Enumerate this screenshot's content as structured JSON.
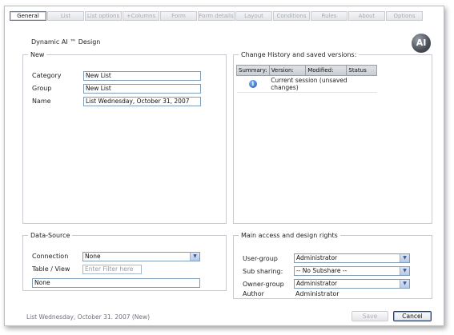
{
  "tabs": [
    {
      "label": "General",
      "active": true
    },
    {
      "label": "List",
      "active": false
    },
    {
      "label": "List options",
      "active": false
    },
    {
      "label": "+Columns",
      "active": false
    },
    {
      "label": "Form",
      "active": false
    },
    {
      "label": "Form details",
      "active": false
    },
    {
      "label": "Layout",
      "active": false
    },
    {
      "label": "Conditions",
      "active": false
    },
    {
      "label": "Rules",
      "active": false
    },
    {
      "label": "About",
      "active": false
    },
    {
      "label": "Options",
      "active": false
    }
  ],
  "page_title": "Dynamic AI ™ Design",
  "logo_text": "AI",
  "new_section": {
    "legend": "New",
    "category_label": "Category",
    "category_value": "New List",
    "group_label": "Group",
    "group_value": "New List",
    "name_label": "Name",
    "name_value": "List Wednesday, October 31, 2007"
  },
  "history_section": {
    "legend": "Change History and saved versions:",
    "columns": [
      "Summary:",
      "Version:",
      "Modified:",
      "Status"
    ],
    "rows": [
      {
        "icon": "info-icon",
        "text": "Current session (unsaved changes)"
      }
    ]
  },
  "datasource_section": {
    "legend": "Data-Source",
    "connection_label": "Connection",
    "connection_value": "None",
    "tableview_label": "Table / View",
    "filter_placeholder": "Enter Filter here",
    "selected_value": "None"
  },
  "access_section": {
    "legend": "Main access and design rights",
    "usergroup_label": "User-group",
    "usergroup_value": "Administrator",
    "subsharing_label": "Sub sharing:",
    "subsharing_value": "-- No Subshare --",
    "ownergroup_label": "Owner-group",
    "ownergroup_value": "Administrator",
    "author_label": "Author",
    "author_value": "Administrator"
  },
  "status_text": "List Wednesday, October 31. 2007 (New)",
  "buttons": {
    "save": "Save",
    "cancel": "Cancel"
  }
}
